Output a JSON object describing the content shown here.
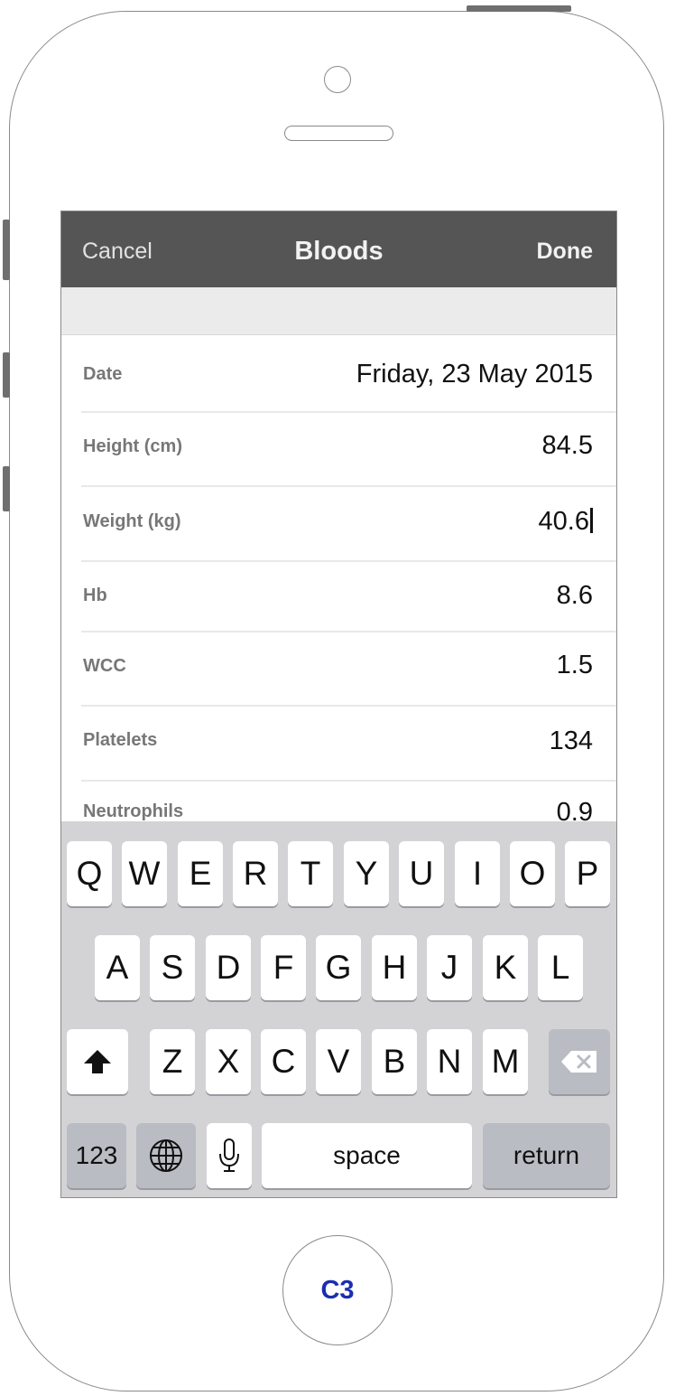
{
  "navbar": {
    "cancel_label": "Cancel",
    "title": "Bloods",
    "done_label": "Done"
  },
  "fields": [
    {
      "label": "Date",
      "value": "Friday, 23 May 2015"
    },
    {
      "label": "Height (cm)",
      "value": "84.5"
    },
    {
      "label": "Weight (kg)",
      "value": "40.6"
    },
    {
      "label": "Hb",
      "value": "8.6"
    },
    {
      "label": "WCC",
      "value": "1.5"
    },
    {
      "label": "Platelets",
      "value": "134"
    },
    {
      "label": "Neutrophils",
      "value": "0.9"
    }
  ],
  "keyboard": {
    "row1": [
      "Q",
      "W",
      "E",
      "R",
      "T",
      "Y",
      "U",
      "I",
      "O",
      "P"
    ],
    "row2": [
      "A",
      "S",
      "D",
      "F",
      "G",
      "H",
      "J",
      "K",
      "L"
    ],
    "row3": [
      "Z",
      "X",
      "C",
      "V",
      "B",
      "N",
      "M"
    ],
    "numbers_label": "123",
    "space_label": "space",
    "return_label": "return",
    "icons": {
      "shift": "shift-arrow-icon",
      "delete": "backspace-icon",
      "globe": "globe-icon",
      "mic": "microphone-icon"
    }
  },
  "home_button": {
    "label": "C3",
    "color": "#1a2eb0"
  },
  "colors": {
    "navbar": "#555555",
    "keyboard": "#d3d3d6"
  }
}
